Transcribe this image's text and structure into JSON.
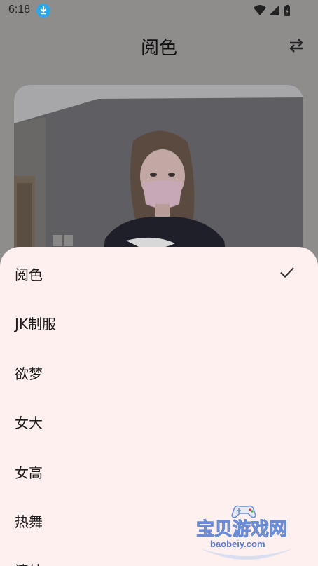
{
  "status_bar": {
    "time": "6:18",
    "icons": [
      "download-notification-icon",
      "wifi-icon",
      "signal-icon",
      "battery-icon"
    ]
  },
  "header": {
    "title": "阅色",
    "action_icon": "swap-arrows-icon"
  },
  "colors": {
    "sheet_background": "#fff0f0",
    "overlay": "#8f8c8c",
    "download_badge": "#2aa8ea"
  },
  "sheet": {
    "items": [
      {
        "label": "阅色",
        "selected": true
      },
      {
        "label": "JK制服",
        "selected": false
      },
      {
        "label": "欲梦",
        "selected": false
      },
      {
        "label": "女大",
        "selected": false
      },
      {
        "label": "女高",
        "selected": false
      },
      {
        "label": "热舞",
        "selected": false
      },
      {
        "label": "清纯",
        "selected": false
      }
    ]
  },
  "watermark": {
    "title": "宝贝游戏网",
    "url": "baobeiy.com"
  }
}
